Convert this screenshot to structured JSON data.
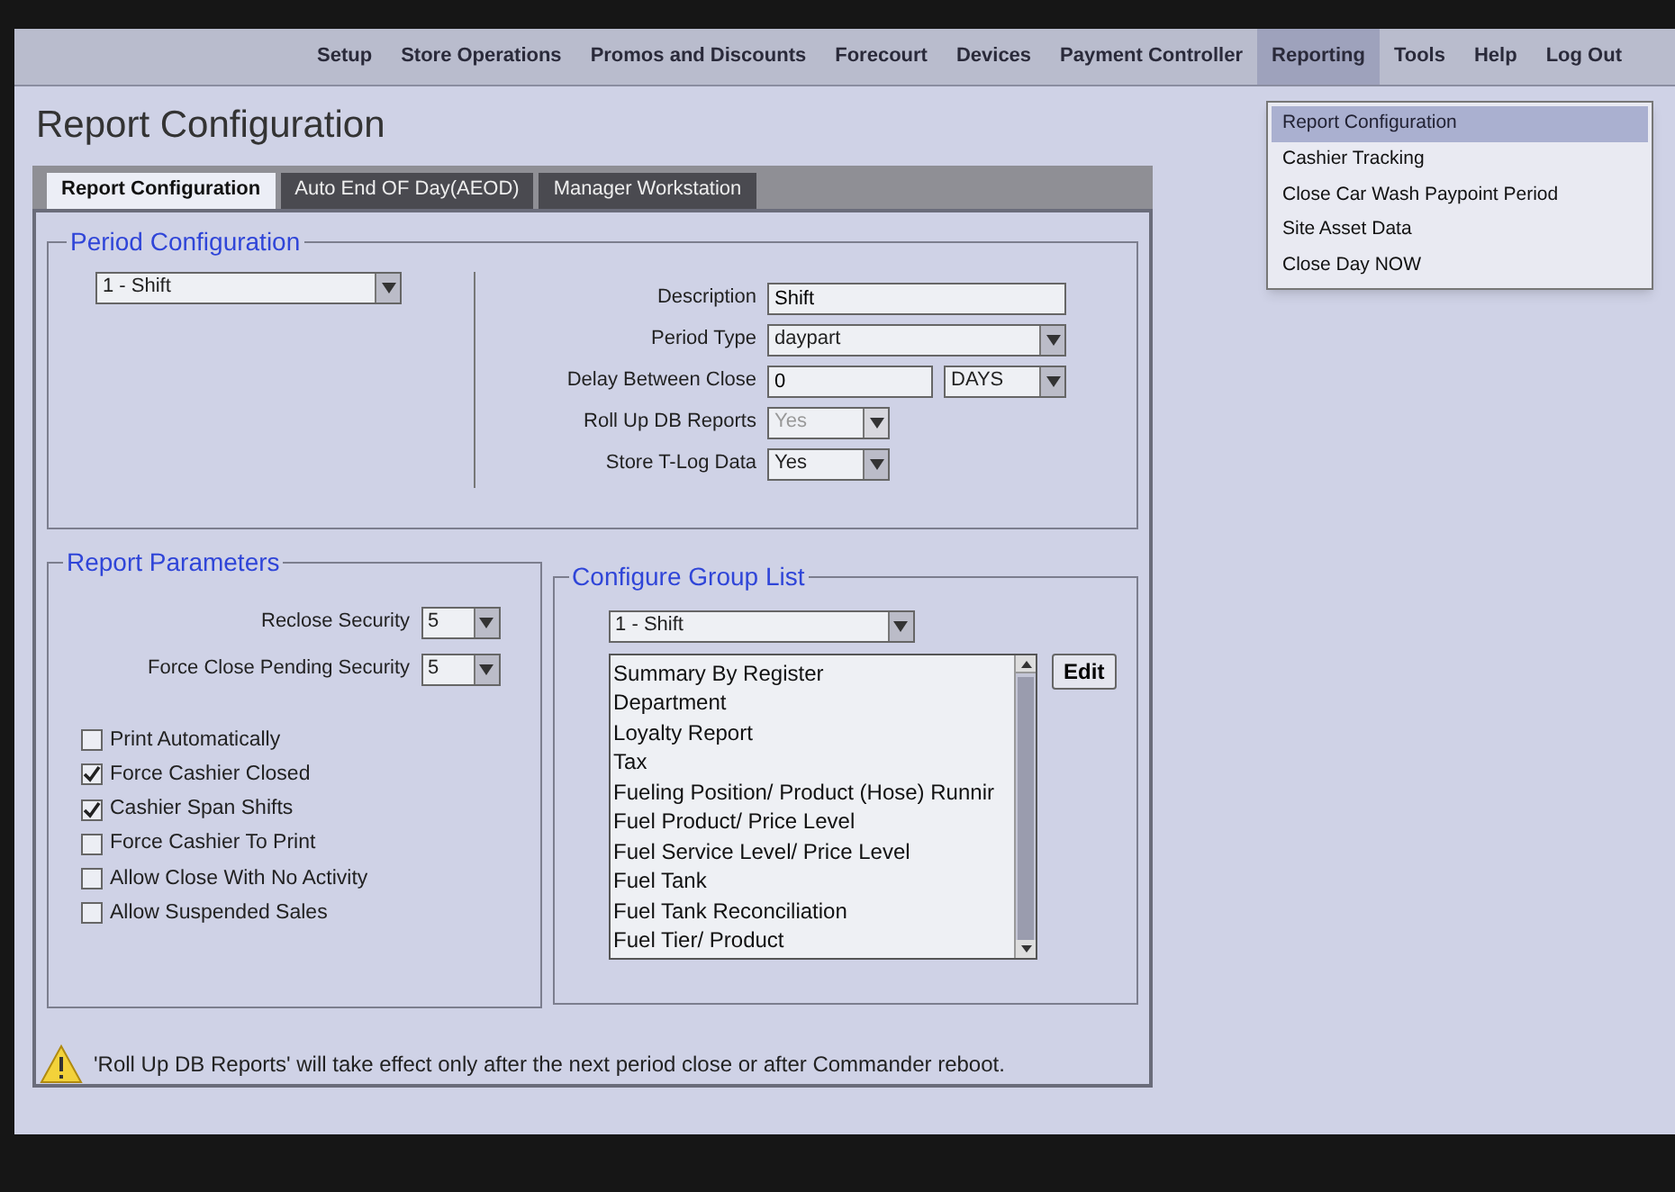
{
  "menu": [
    {
      "label": "Setup",
      "selected": false
    },
    {
      "label": "Store Operations",
      "selected": false
    },
    {
      "label": "Promos and Discounts",
      "selected": false
    },
    {
      "label": "Forecourt",
      "selected": false
    },
    {
      "label": "Devices",
      "selected": false
    },
    {
      "label": "Payment Controller",
      "selected": false
    },
    {
      "label": "Reporting",
      "selected": true
    },
    {
      "label": "Tools",
      "selected": false
    },
    {
      "label": "Help",
      "selected": false
    },
    {
      "label": "Log Out",
      "selected": false
    }
  ],
  "dropdown": [
    {
      "label": "Report Configuration",
      "selected": true
    },
    {
      "label": "Cashier Tracking",
      "selected": false
    },
    {
      "label": "Close Car Wash Paypoint Period",
      "selected": false
    },
    {
      "label": "Site Asset Data",
      "selected": false
    },
    {
      "label": "Close Day NOW",
      "selected": false
    }
  ],
  "page_title": "Report Configuration",
  "tabs": [
    {
      "label": "Report Configuration",
      "selected": true
    },
    {
      "label": "Auto End OF Day(AEOD)",
      "selected": false
    },
    {
      "label": "Manager Workstation",
      "selected": false
    }
  ],
  "period_configuration": {
    "title": "Period Configuration",
    "period_select": "1 - Shift",
    "fields": [
      {
        "label": "Description",
        "kind": "text",
        "value": "Shift",
        "disabled": false
      },
      {
        "label": "Period Type",
        "kind": "select",
        "value": "daypart",
        "disabled": false
      },
      {
        "label": "Delay Between Close",
        "kind": "text_unit",
        "value": "0",
        "unit": "DAYS",
        "disabled": false
      },
      {
        "label": "Roll Up DB Reports",
        "kind": "small_select",
        "value": "Yes",
        "disabled": true
      },
      {
        "label": "Store T-Log Data",
        "kind": "small_select",
        "value": "Yes",
        "disabled": false
      }
    ]
  },
  "report_parameters": {
    "title": "Report Parameters",
    "selects": [
      {
        "label": "Reclose Security",
        "value": "5"
      },
      {
        "label": "Force Close Pending Security",
        "value": "5"
      }
    ],
    "checkboxes": [
      {
        "label": "Print Automatically",
        "checked": false
      },
      {
        "label": "Force Cashier Closed",
        "checked": true
      },
      {
        "label": "Cashier Span Shifts",
        "checked": true
      },
      {
        "label": "Force Cashier To Print",
        "checked": false
      },
      {
        "label": "Allow Close With No Activity",
        "checked": false
      },
      {
        "label": "Allow Suspended Sales",
        "checked": false
      }
    ]
  },
  "group_list": {
    "title": "Configure Group List",
    "select": "1 - Shift",
    "items": [
      "Summary By Register",
      "Department",
      "Loyalty Report",
      "Tax",
      "Fueling Position/ Product (Hose) Runnir",
      "Fuel Product/ Price Level",
      "Fuel Service Level/ Price Level",
      "Fuel Tank",
      "Fuel Tank Reconciliation",
      "Fuel Tier/ Product"
    ],
    "edit_button": "Edit"
  },
  "notice": "'Roll Up DB Reports' will take effect only after the next period close or after Commander reboot."
}
